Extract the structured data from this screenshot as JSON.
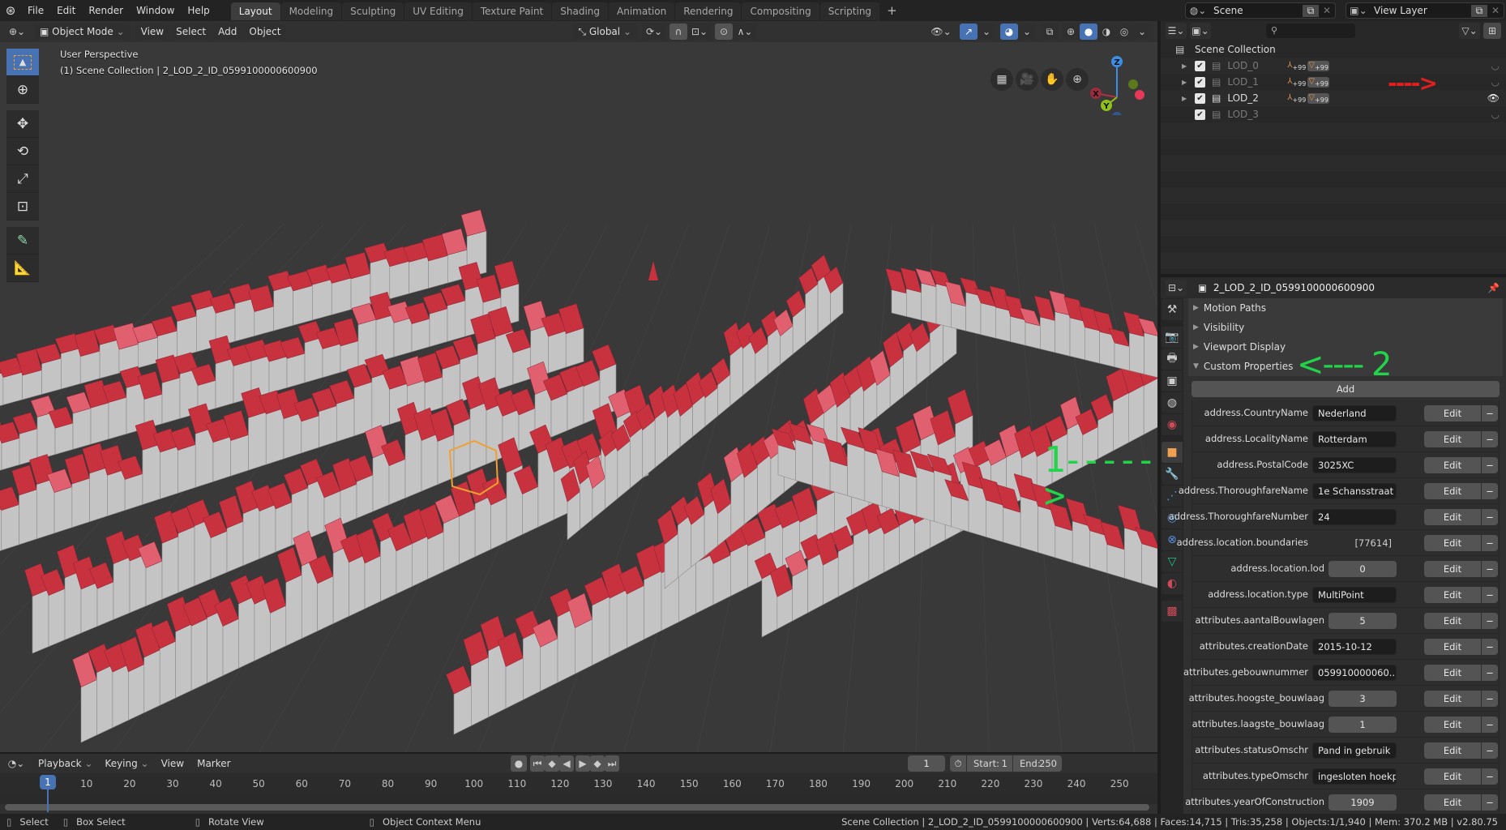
{
  "app": {
    "title": "Blender",
    "version": "v2.80.75"
  },
  "topbar": {
    "menus": [
      "File",
      "Edit",
      "Render",
      "Window",
      "Help"
    ],
    "workspaces": [
      "Layout",
      "Modeling",
      "Sculpting",
      "UV Editing",
      "Texture Paint",
      "Shading",
      "Animation",
      "Rendering",
      "Compositing",
      "Scripting"
    ],
    "active_workspace": "Layout",
    "add_workspace": "+",
    "scene": "Scene",
    "view_layer": "View Layer"
  },
  "viewport": {
    "mode": "Object Mode",
    "menus": [
      "View",
      "Select",
      "Add",
      "Object"
    ],
    "orientation": "Global",
    "overlay_title": "User Perspective",
    "overlay_subtitle": "(1) Scene Collection | 2_LOD_2_ID_0599100000600900",
    "gizmo_axes": [
      "X",
      "Y",
      "Z"
    ],
    "tools": [
      "select-box",
      "cursor",
      "move",
      "rotate",
      "scale",
      "transform",
      "annotate",
      "measure"
    ],
    "annotation_1": "1----->",
    "colors": {
      "roof": "#c8323f",
      "wall": "#c4c4c4",
      "selection": "#f0a030",
      "background": "#393939"
    }
  },
  "outliner": {
    "search_placeholder": "",
    "root": "Scene Collection",
    "collections": [
      {
        "name": "LOD_0",
        "checked": true,
        "visible": false,
        "badge1": "+99",
        "badge2": "+99"
      },
      {
        "name": "LOD_1",
        "checked": true,
        "visible": false,
        "badge1": "+99",
        "badge2": "+99"
      },
      {
        "name": "LOD_2",
        "checked": true,
        "visible": true,
        "badge1": "+99",
        "badge2": "+99"
      },
      {
        "name": "LOD_3",
        "checked": true,
        "visible": false
      }
    ],
    "annotation_arrow": "---->"
  },
  "properties": {
    "object_name": "2_LOD_2_ID_0599100000600900",
    "panels": [
      "Motion Paths",
      "Visibility",
      "Viewport Display",
      "Custom Properties"
    ],
    "annotation_2": "<---- 2",
    "add_label": "Add",
    "edit_label": "Edit",
    "remove_label": "−",
    "custom_props": [
      {
        "key": "address.CountryName",
        "value": "Nederland",
        "kind": "text"
      },
      {
        "key": "address.LocalityName",
        "value": "Rotterdam",
        "kind": "text"
      },
      {
        "key": "address.PostalCode",
        "value": "3025XC",
        "kind": "text"
      },
      {
        "key": "address.ThoroughfareName",
        "value": "1e Schansstraat",
        "kind": "text"
      },
      {
        "key": "address.ThoroughfareNumber",
        "value": "24",
        "kind": "text"
      },
      {
        "key": "address.location.boundaries",
        "value": "[77614]",
        "kind": "array"
      },
      {
        "key": "address.location.lod",
        "value": "0",
        "kind": "num"
      },
      {
        "key": "address.location.type",
        "value": "MultiPoint",
        "kind": "text"
      },
      {
        "key": "attributes.aantalBouwlagen",
        "value": "5",
        "kind": "num"
      },
      {
        "key": "attributes.creationDate",
        "value": "2015-10-12",
        "kind": "text"
      },
      {
        "key": "attributes.gebouwnummer",
        "value": "059910000060..",
        "kind": "text"
      },
      {
        "key": "attributes.hoogste_bouwlaag",
        "value": "3",
        "kind": "num"
      },
      {
        "key": "attributes.laagste_bouwlaag",
        "value": "1",
        "kind": "num"
      },
      {
        "key": "attributes.statusOmschr",
        "value": "Pand in gebruik",
        "kind": "text"
      },
      {
        "key": "attributes.typeOmschr",
        "value": "ingesloten hoekp..",
        "kind": "text"
      },
      {
        "key": "attributes.yearOfConstruction",
        "value": "1909",
        "kind": "num"
      }
    ]
  },
  "timeline": {
    "menus": [
      "Playback",
      "Keying",
      "View",
      "Marker"
    ],
    "current_frame": "1",
    "start_label": "Start:",
    "start": "1",
    "end_label": "End:",
    "end": "250",
    "ticks": [
      "10",
      "20",
      "30",
      "40",
      "50",
      "60",
      "70",
      "80",
      "90",
      "100",
      "110",
      "120",
      "130",
      "140",
      "150",
      "160",
      "170",
      "180",
      "190",
      "200",
      "210",
      "220",
      "230",
      "240",
      "250"
    ]
  },
  "statusbar": {
    "hints": [
      "Select",
      "Box Select",
      "Rotate View",
      "Object Context Menu"
    ],
    "info": "Scene Collection | 2_LOD_2_ID_0599100000600900 | Verts:64,688 | Faces:14,715 | Tris:35,258 | Objects:1/1,940 | Mem: 370.2 MB | v2.80.75"
  }
}
